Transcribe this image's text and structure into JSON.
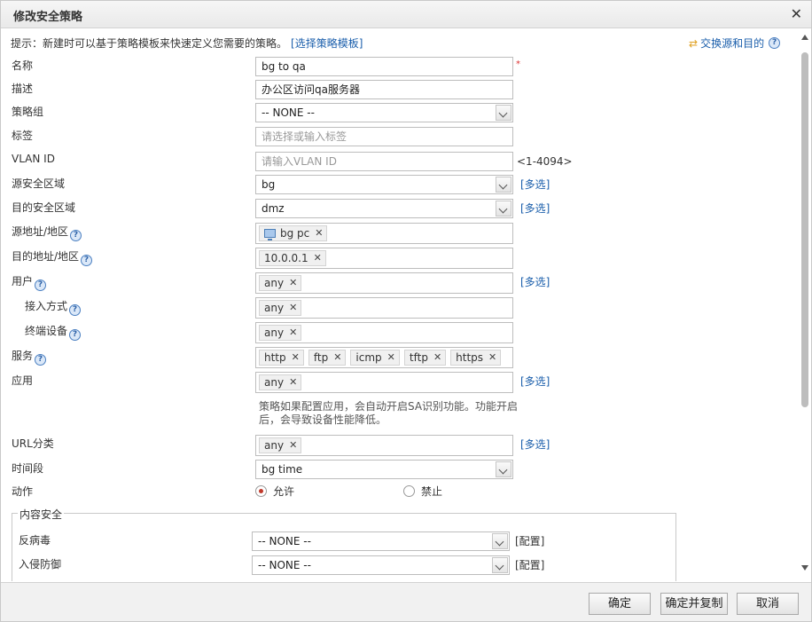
{
  "dialog": {
    "title": "修改安全策略"
  },
  "hint": {
    "text": "提示：新建时可以基于策略模板来快速定义您需要的策略。",
    "link": "[选择策略模板]"
  },
  "swap": {
    "label": "交换源和目的"
  },
  "fields": {
    "name": {
      "label": "名称",
      "value": "bg to qa",
      "required": "*"
    },
    "description": {
      "label": "描述",
      "value": "办公区访问qa服务器"
    },
    "policy_group": {
      "label": "策略组",
      "value": "-- NONE --"
    },
    "tag": {
      "label": "标签",
      "placeholder": "请选择或输入标签"
    },
    "vlan": {
      "label": "VLAN ID",
      "placeholder": "请输入VLAN ID",
      "range": "<1-4094>"
    },
    "src_zone": {
      "label": "源安全区域",
      "value": "bg",
      "multi": "[多选]"
    },
    "dst_zone": {
      "label": "目的安全区域",
      "value": "dmz",
      "multi": "[多选]"
    },
    "src_addr": {
      "label": "源地址/地区",
      "tags": [
        "bg pc"
      ]
    },
    "dst_addr": {
      "label": "目的地址/地区",
      "tags": [
        "10.0.0.1"
      ]
    },
    "user": {
      "label": "用户",
      "tags": [
        "any"
      ],
      "multi": "[多选]"
    },
    "access_mode": {
      "label": "接入方式",
      "tags": [
        "any"
      ]
    },
    "terminal": {
      "label": "终端设备",
      "tags": [
        "any"
      ]
    },
    "service": {
      "label": "服务",
      "tags": [
        "http",
        "ftp",
        "icmp",
        "tftp",
        "https"
      ]
    },
    "application": {
      "label": "应用",
      "tags": [
        "any"
      ],
      "multi": "[多选]",
      "note": "策略如果配置应用，会自动开启SA识别功能。功能开启后，会导致设备性能降低。"
    },
    "url_category": {
      "label": "URL分类",
      "tags": [
        "any"
      ],
      "multi": "[多选]"
    },
    "schedule": {
      "label": "时间段",
      "value": "bg time"
    },
    "action": {
      "label": "动作",
      "allow": "允许",
      "deny": "禁止",
      "selected": "allow"
    }
  },
  "content_security": {
    "legend": "内容安全",
    "antivirus": {
      "label": "反病毒",
      "value": "-- NONE --",
      "config": "[配置]"
    },
    "ips": {
      "label": "入侵防御",
      "value": "-- NONE --",
      "config": "[配置]"
    }
  },
  "buttons": {
    "ok": "确定",
    "ok_copy": "确定并复制",
    "cancel": "取消"
  }
}
